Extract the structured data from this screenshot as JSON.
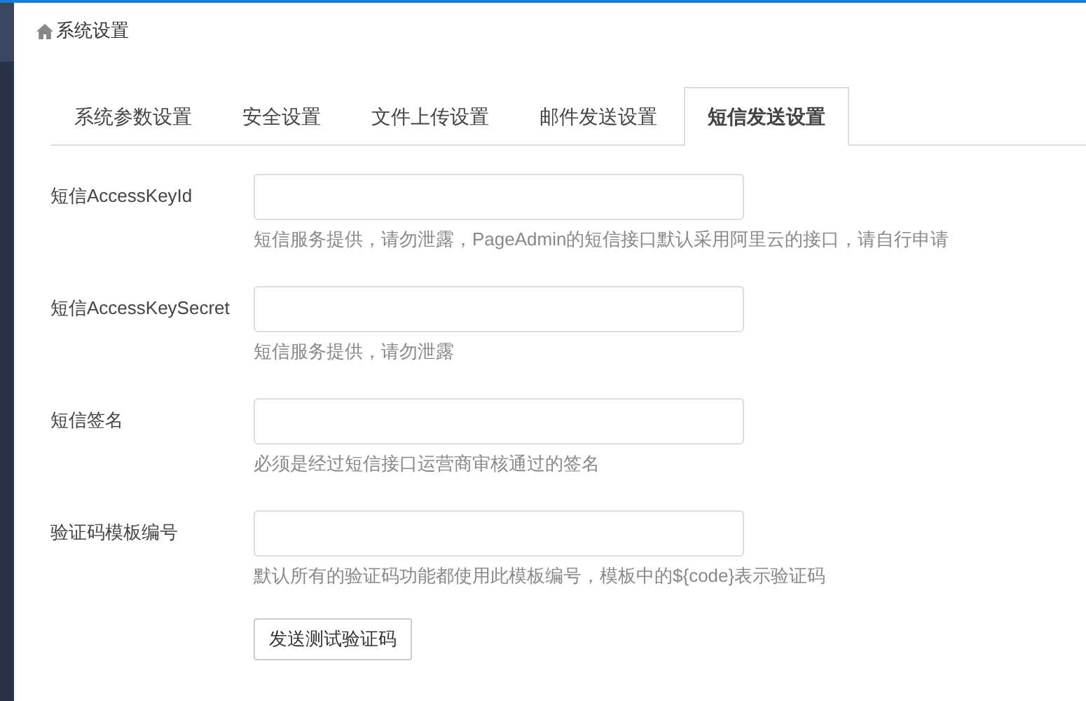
{
  "breadcrumb": {
    "title": "系统设置"
  },
  "tabs": [
    {
      "label": "系统参数设置",
      "selected": false
    },
    {
      "label": "安全设置",
      "selected": false
    },
    {
      "label": "文件上传设置",
      "selected": false
    },
    {
      "label": "邮件发送设置",
      "selected": false
    },
    {
      "label": "短信发送设置",
      "selected": true
    }
  ],
  "fields": [
    {
      "label": "短信AccessKeyId",
      "hint": "短信服务提供，请勿泄露，PageAdmin的短信接口默认采用阿里云的接口，请自行申请"
    },
    {
      "label": "短信AccessKeySecret",
      "hint": "短信服务提供，请勿泄露"
    },
    {
      "label": "短信签名",
      "hint": "必须是经过短信接口运营商审核通过的签名"
    },
    {
      "label": "验证码模板编号",
      "hint": "默认所有的验证码功能都使用此模板编号，模板中的${code}表示验证码"
    }
  ],
  "button": "发送测试验证码"
}
